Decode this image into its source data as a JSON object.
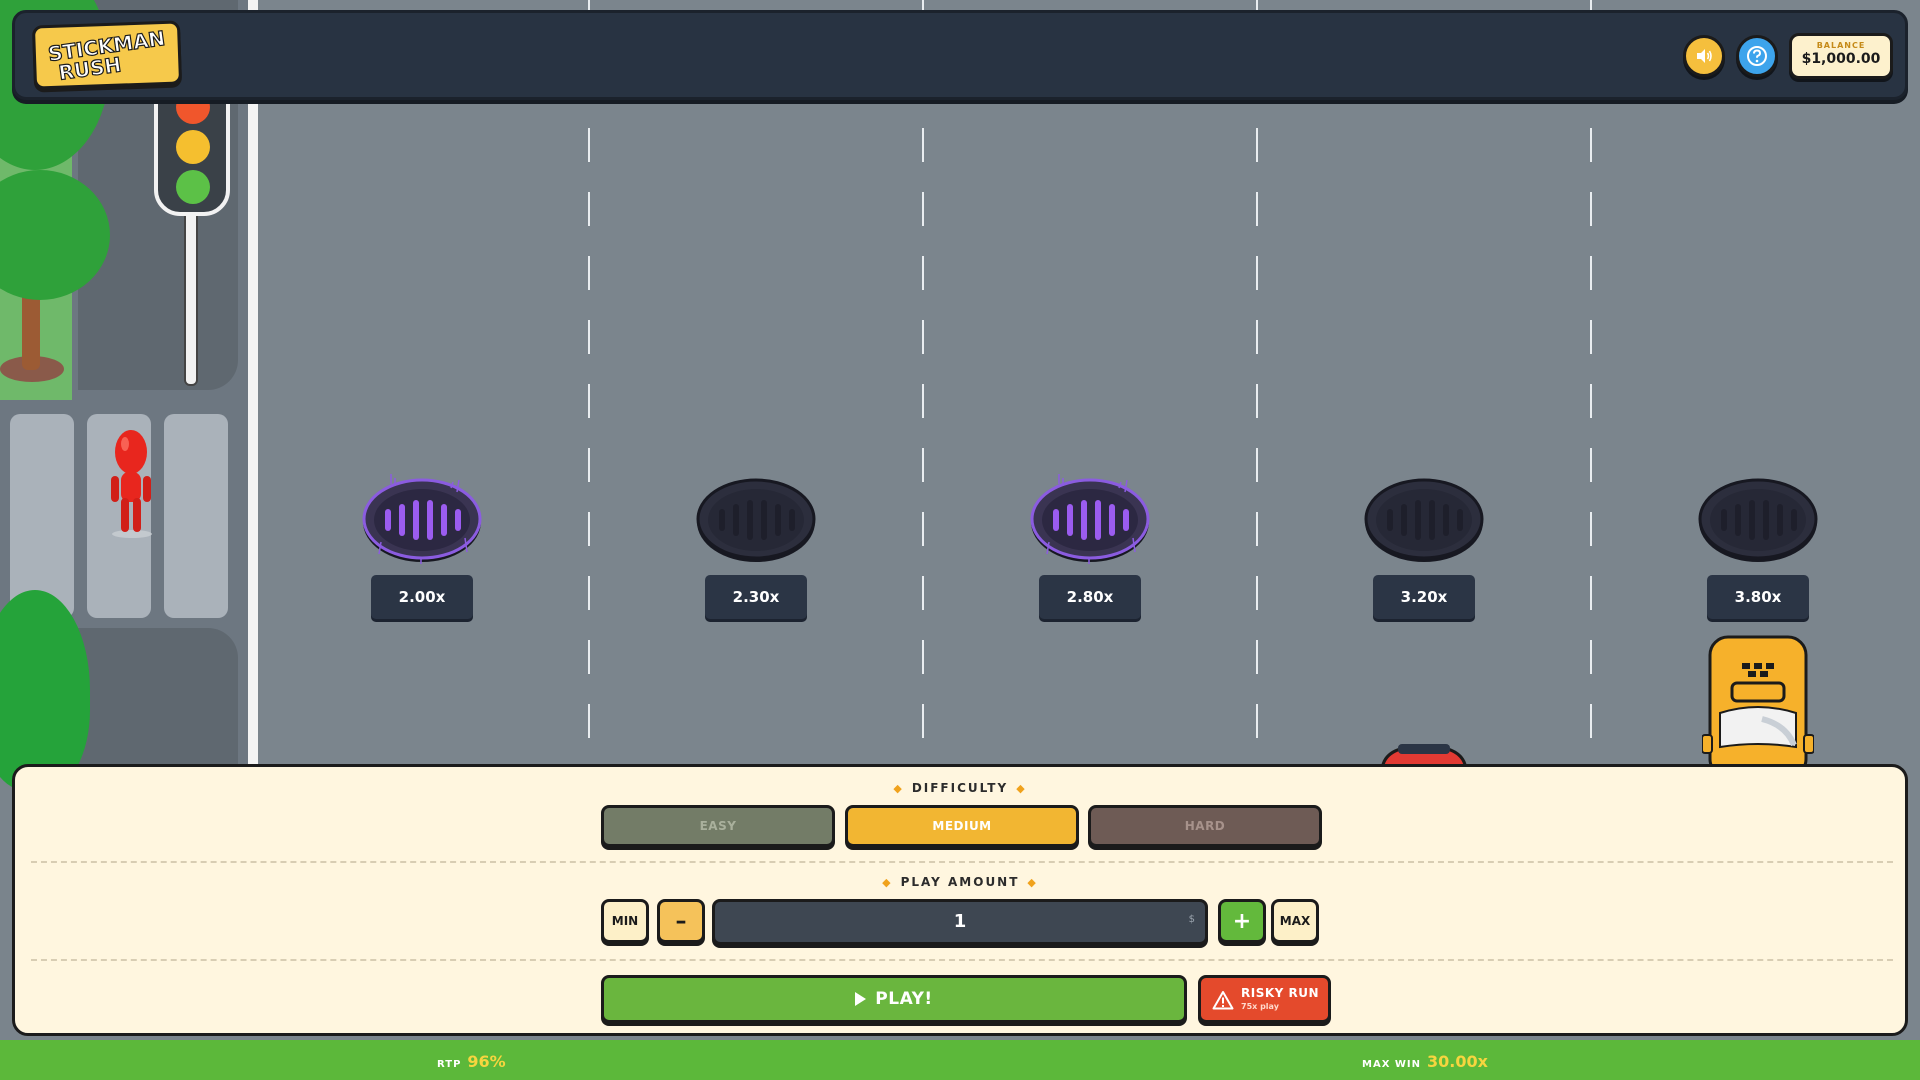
{
  "game": {
    "logo_line1": "STICKMAN",
    "logo_line2": "RUSH"
  },
  "header": {
    "sound_icon": "speaker-icon",
    "help_icon": "question-icon",
    "balance_label": "BALANCE",
    "balance_value": "$1,000.00"
  },
  "lanes": [
    {
      "multiplier": "2.00x",
      "state": "active"
    },
    {
      "multiplier": "2.30x",
      "state": "idle"
    },
    {
      "multiplier": "2.80x",
      "state": "active"
    },
    {
      "multiplier": "3.20x",
      "state": "idle"
    },
    {
      "multiplier": "3.80x",
      "state": "idle"
    }
  ],
  "difficulty": {
    "title": "DIFFICULTY",
    "options": [
      "EASY",
      "MEDIUM",
      "HARD"
    ],
    "selected": "MEDIUM"
  },
  "play_amount": {
    "title": "PLAY AMOUNT",
    "min_label": "MIN",
    "minus_label": "–",
    "value": "1",
    "currency": "$",
    "plus_label": "+",
    "max_label": "MAX"
  },
  "actions": {
    "play_label": "PLAY!",
    "risky_title": "RISKY RUN",
    "risky_subtitle": "75x play"
  },
  "footer": {
    "rtp_label": "RTP",
    "rtp_value": "96%",
    "max_win_label": "MAX WIN",
    "max_win_value": "30.00x"
  },
  "colors": {
    "accent": "#f2b632",
    "play": "#6ab63e",
    "risky": "#e44a2c",
    "topbar": "#283342"
  }
}
